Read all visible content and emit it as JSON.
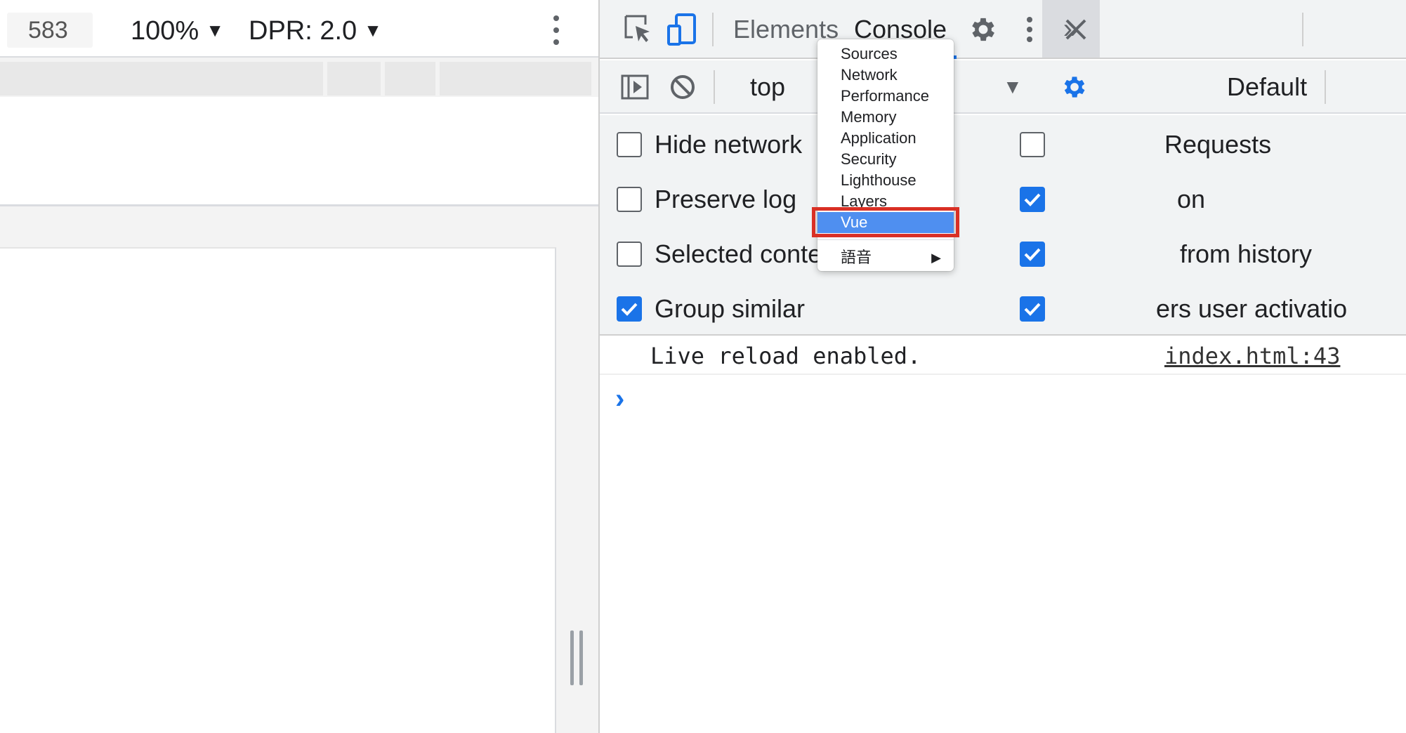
{
  "device_toolbar": {
    "width_value": "583",
    "zoom": "100%",
    "dpr": "DPR: 2.0"
  },
  "devtools": {
    "tabs": [
      {
        "label": "Elements"
      },
      {
        "label": "Console"
      }
    ],
    "more_tabs_icon": "»",
    "console_toolbar": {
      "context": "top",
      "levels": "Default"
    },
    "settings_left": [
      {
        "label": "Hide network",
        "checked": false
      },
      {
        "label": "Preserve log",
        "checked": false
      },
      {
        "label": "Selected context only",
        "checked": false
      },
      {
        "label": "Group similar",
        "checked": true
      }
    ],
    "settings_right": [
      {
        "label": "Requests",
        "checked": false
      },
      {
        "label": "on",
        "checked": true
      },
      {
        "label": "from history",
        "checked": true
      },
      {
        "label": "ers user activatio",
        "checked": true
      }
    ],
    "log": {
      "message": "Live reload enabled.",
      "source": "index.html:43"
    },
    "prompt_symbol": "›"
  },
  "overflow_menu": {
    "items": [
      {
        "label": "Sources"
      },
      {
        "label": "Network"
      },
      {
        "label": "Performance"
      },
      {
        "label": "Memory"
      },
      {
        "label": "Application"
      },
      {
        "label": "Security"
      },
      {
        "label": "Lighthouse"
      },
      {
        "label": "Layers"
      },
      {
        "label": "Vue",
        "selected": true
      }
    ],
    "submenu": {
      "label": "語音",
      "arrow": "▶"
    }
  },
  "colors": {
    "accent": "#1a73e8",
    "menu_selected": "#4f8ff0",
    "annotation": "#d93025"
  },
  "icons": [
    "inspect-element-icon",
    "device-toggle-icon",
    "settings-gear-icon",
    "more-vert-icon",
    "close-icon",
    "sidebar-toggle-icon",
    "clear-console-icon",
    "console-settings-icon"
  ]
}
